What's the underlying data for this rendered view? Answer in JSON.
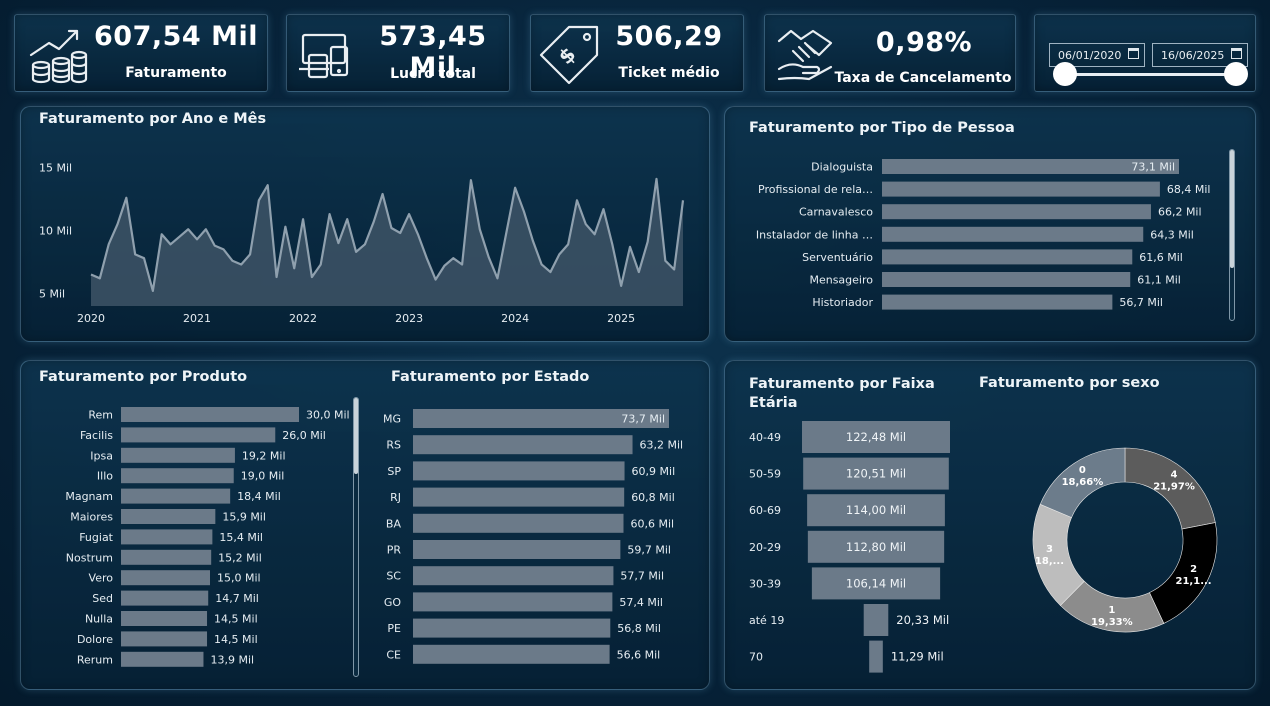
{
  "kpis": [
    {
      "value": "607,54 Mil",
      "label": "Faturamento",
      "icon": "money-growth-icon"
    },
    {
      "value": "573,45 Mil",
      "label": "Lucro total",
      "icon": "devices-icon"
    },
    {
      "value": "506,29",
      "label": "Ticket médio",
      "icon": "price-tag-icon"
    },
    {
      "value": "0,98%",
      "label": "Taxa de Cancelamento",
      "icon": "handshake-icon"
    }
  ],
  "filter": {
    "start_date": "06/01/2020",
    "end_date": "16/06/2025",
    "icon": "calendar-icon"
  },
  "panels": {
    "ano_mes": "Faturamento por Ano e Mês",
    "tipo_pessoa": "Faturamento por Tipo de Pessoa",
    "produto": "Faturamento por Produto",
    "estado": "Faturamento por Estado",
    "faixa_etaria_1": "Faturamento por Faixa",
    "faixa_etaria_2": "Etária",
    "sexo": "Faturamento por sexo"
  },
  "colors": {
    "bar": "#6b7a89",
    "line": "#8fa0ae",
    "area": "#3d5466",
    "background": "#07233a"
  },
  "chart_data": [
    {
      "type": "area",
      "title": "Faturamento por Ano e Mês",
      "x_ticks": [
        "2020",
        "2021",
        "2022",
        "2023",
        "2024",
        "2025"
      ],
      "y_ticks": [
        "5 Mil",
        "10 Mil",
        "15 Mil"
      ],
      "ylim": [
        4000,
        16000
      ],
      "x": [
        "2020-01",
        "2020-02",
        "2020-03",
        "2020-04",
        "2020-05",
        "2020-06",
        "2020-07",
        "2020-08",
        "2020-09",
        "2020-10",
        "2020-11",
        "2020-12",
        "2021-01",
        "2021-02",
        "2021-03",
        "2021-04",
        "2021-05",
        "2021-06",
        "2021-07",
        "2021-08",
        "2021-09",
        "2021-10",
        "2021-11",
        "2021-12",
        "2022-01",
        "2022-02",
        "2022-03",
        "2022-04",
        "2022-05",
        "2022-06",
        "2022-07",
        "2022-08",
        "2022-09",
        "2022-10",
        "2022-11",
        "2022-12",
        "2023-01",
        "2023-02",
        "2023-03",
        "2023-04",
        "2023-05",
        "2023-06",
        "2023-07",
        "2023-08",
        "2023-09",
        "2023-10",
        "2023-11",
        "2023-12",
        "2024-01",
        "2024-02",
        "2024-03",
        "2024-04",
        "2024-05",
        "2024-06",
        "2024-07",
        "2024-08",
        "2024-09",
        "2024-10",
        "2024-11",
        "2024-12",
        "2025-01",
        "2025-02",
        "2025-03",
        "2025-04",
        "2025-05",
        "2025-06"
      ],
      "values": [
        6500,
        6200,
        8900,
        10500,
        12600,
        8100,
        7800,
        5200,
        9700,
        8900,
        9500,
        10100,
        9300,
        10100,
        8800,
        8500,
        7600,
        7300,
        8100,
        12400,
        13600,
        6300,
        10300,
        7000,
        10900,
        6300,
        7300,
        11300,
        9000,
        10900,
        8300,
        8900,
        10700,
        12900,
        10200,
        9800,
        11300,
        9700,
        7800,
        6100,
        7200,
        7800,
        7300,
        14000,
        10100,
        7900,
        6200,
        9800,
        13400,
        11500,
        9200,
        7300,
        6700,
        8100,
        8900,
        12400,
        10500,
        9700,
        11700,
        8900,
        5600,
        8700,
        6700,
        9100,
        14100,
        7600,
        6900,
        12400
      ],
      "series": [
        {
          "name": "Faturamento"
        }
      ]
    },
    {
      "type": "bar",
      "title": "Faturamento por Tipo de Pessoa",
      "categories": [
        "Dialoguista",
        "Profissional de rela…",
        "Carnavalesco",
        "Instalador de linha …",
        "Serventuário",
        "Mensageiro",
        "Historiador"
      ],
      "values": [
        73.1,
        68.4,
        66.2,
        64.3,
        61.6,
        61.1,
        56.7
      ],
      "labels": [
        "73,1 Mil",
        "68,4 Mil",
        "66,2 Mil",
        "64,3 Mil",
        "61,6 Mil",
        "61,1 Mil",
        "56,7 Mil"
      ],
      "xlim": [
        0,
        77
      ]
    },
    {
      "type": "bar",
      "title": "Faturamento por Produto",
      "categories": [
        "Rem",
        "Facilis",
        "Ipsa",
        "Illo",
        "Magnam",
        "Maiores",
        "Fugiat",
        "Nostrum",
        "Vero",
        "Sed",
        "Nulla",
        "Dolore",
        "Rerum"
      ],
      "values": [
        30.0,
        26.0,
        19.2,
        19.0,
        18.4,
        15.9,
        15.4,
        15.2,
        15.0,
        14.7,
        14.5,
        14.5,
        13.9
      ],
      "labels": [
        "30,0 Mil",
        "26,0 Mil",
        "19,2 Mil",
        "19,0 Mil",
        "18,4 Mil",
        "15,9 Mil",
        "15,4 Mil",
        "15,2 Mil",
        "15,0 Mil",
        "14,7 Mil",
        "14,5 Mil",
        "14,5 Mil",
        "13,9 Mil"
      ],
      "xlim": [
        0,
        30
      ]
    },
    {
      "type": "bar",
      "title": "Faturamento por Estado",
      "categories": [
        "MG",
        "RS",
        "SP",
        "RJ",
        "BA",
        "PR",
        "SC",
        "GO",
        "PE",
        "CE"
      ],
      "values": [
        73.7,
        63.2,
        60.9,
        60.8,
        60.6,
        59.7,
        57.7,
        57.4,
        56.8,
        56.6
      ],
      "labels": [
        "73,7 Mil",
        "63,2 Mil",
        "60,9 Mil",
        "60,8 Mil",
        "60,6 Mil",
        "59,7 Mil",
        "57,7 Mil",
        "57,4 Mil",
        "56,8 Mil",
        "56,6 Mil"
      ],
      "xlim": [
        0,
        80
      ]
    },
    {
      "type": "bar",
      "title": "Faturamento por Faixa Etária",
      "categories": [
        "40-49",
        "50-59",
        "60-69",
        "20-29",
        "30-39",
        "até 19",
        "70"
      ],
      "values": [
        122.48,
        120.51,
        114.0,
        112.8,
        106.14,
        20.33,
        11.29
      ],
      "labels": [
        "122,48 Mil",
        "120,51 Mil",
        "114,00 Mil",
        "112,80 Mil",
        "106,14 Mil",
        "20,33 Mil",
        "11,29 Mil"
      ]
    },
    {
      "type": "pie",
      "title": "Faturamento por sexo",
      "categories": [
        "4",
        "2",
        "1",
        "3",
        "0"
      ],
      "values": [
        21.97,
        21.1,
        19.33,
        18.94,
        18.66
      ],
      "labels": [
        "21,97%",
        "21,1...",
        "19,33%",
        "18,...",
        "18,66%"
      ],
      "colors": [
        "#5c5c5c",
        "#000000",
        "#8c8c8c",
        "#bdbdbd",
        "#6c7c8b"
      ]
    }
  ]
}
